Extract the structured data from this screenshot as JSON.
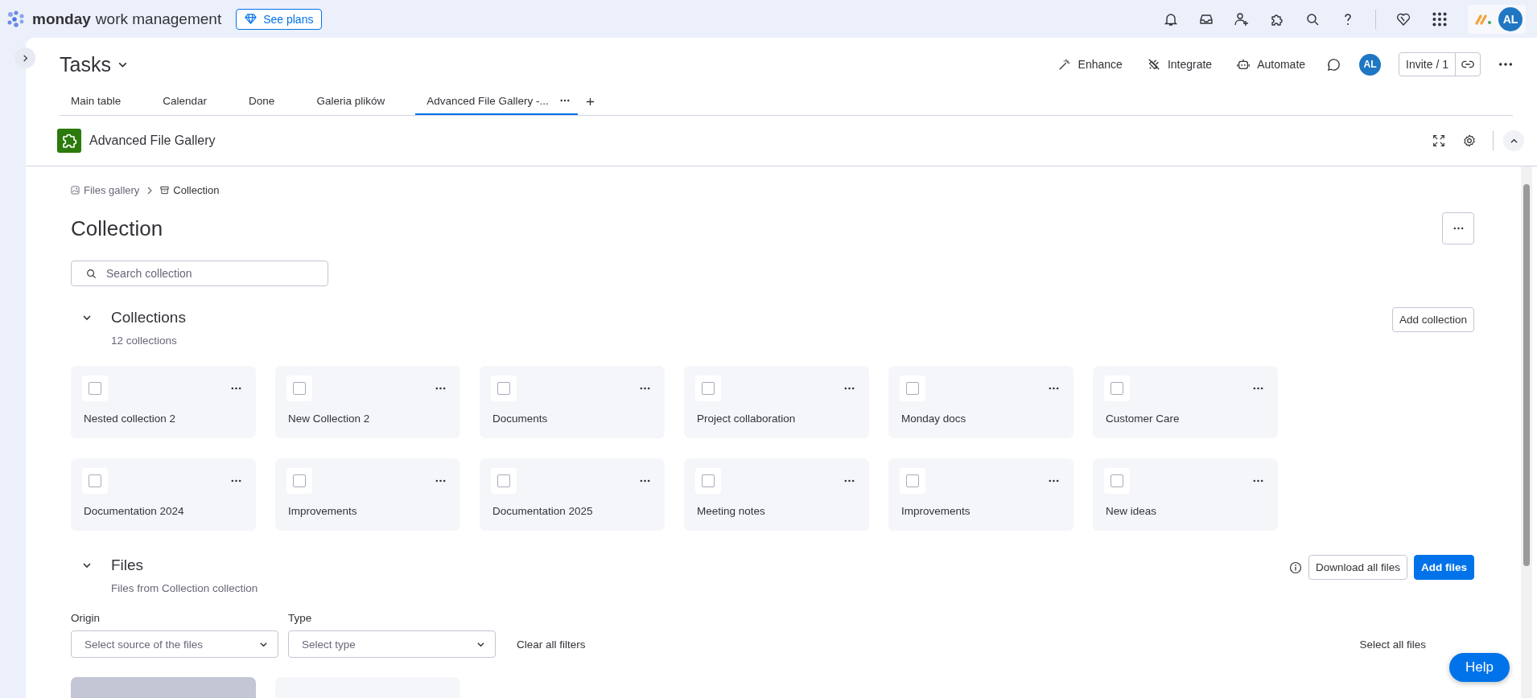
{
  "top_bar": {
    "brand": "monday",
    "product": "work management",
    "see_plans": "See plans",
    "avatar": "AL"
  },
  "board": {
    "title": "Tasks",
    "tabs": [
      {
        "label": "Main table",
        "selected": false
      },
      {
        "label": "Calendar",
        "selected": false
      },
      {
        "label": "Done",
        "selected": false
      },
      {
        "label": "Galeria plików",
        "selected": false
      },
      {
        "label": "Advanced File Gallery -...",
        "selected": true
      }
    ],
    "actions": [
      {
        "label": "Enhance",
        "kind": "wand"
      },
      {
        "label": "Integrate",
        "kind": "plug"
      },
      {
        "label": "Automate",
        "kind": "robot"
      }
    ],
    "avatar": "AL",
    "invite": "Invite / 1"
  },
  "app_header": {
    "title": "Advanced File Gallery"
  },
  "breadcrumb": [
    {
      "label": "Files gallery",
      "kind": "image"
    },
    {
      "label": "Collection",
      "kind": "box"
    }
  ],
  "page_title": "Collection",
  "search": {
    "placeholder": "Search collection"
  },
  "collections": {
    "title": "Collections",
    "count": "12 collections",
    "add_button": "Add collection",
    "expanded": true,
    "items": [
      {
        "name": "Nested collection 2",
        "checked": false
      },
      {
        "name": "New Collection 2",
        "checked": false
      },
      {
        "name": "Documents",
        "checked": false
      },
      {
        "name": "Project collaboration",
        "checked": false
      },
      {
        "name": "Monday docs",
        "checked": false
      },
      {
        "name": "Customer Care",
        "checked": false
      },
      {
        "name": "Documentation 2024",
        "checked": false
      },
      {
        "name": "Improvements",
        "checked": false
      },
      {
        "name": "Documentation 2025",
        "checked": false
      },
      {
        "name": "Meeting notes",
        "checked": false
      },
      {
        "name": "Improvements",
        "checked": false
      },
      {
        "name": "New ideas",
        "checked": false
      }
    ]
  },
  "files": {
    "title": "Files",
    "subtitle": "Files from Collection collection",
    "expanded": true,
    "download": "Download all files",
    "add": "Add files",
    "filters": [
      {
        "label": "Origin",
        "placeholder": "Select source of the files"
      },
      {
        "label": "Type",
        "placeholder": "Select type"
      }
    ],
    "clear": "Clear all filters",
    "select_all": "Select all files",
    "items": [
      {
        "kind": "thumbnail"
      },
      {
        "kind": "empty"
      }
    ]
  },
  "help": "Help"
}
